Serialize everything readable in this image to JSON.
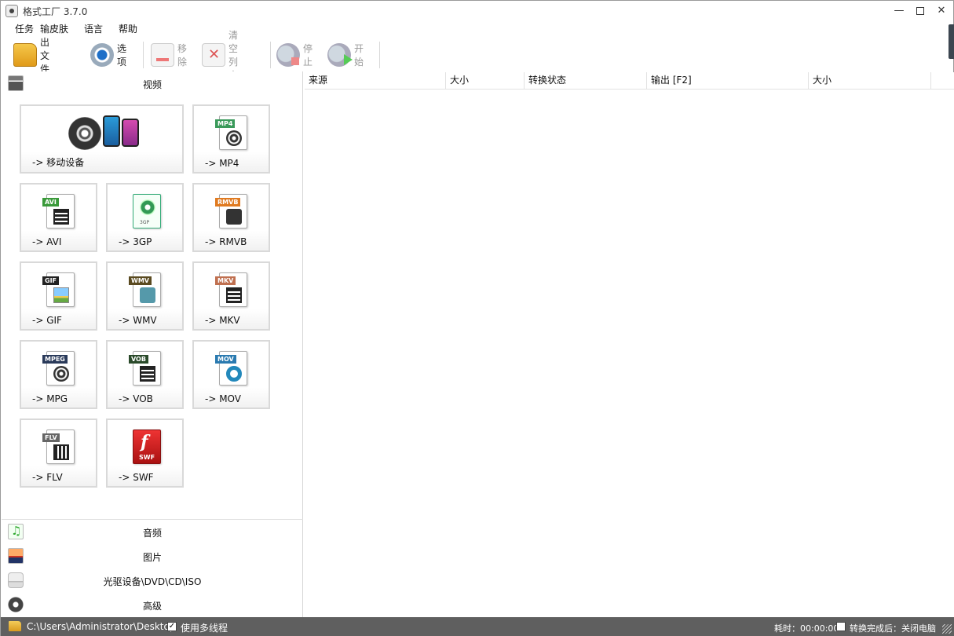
{
  "window": {
    "title": "格式工厂 3.7.0",
    "min": "—",
    "close": "✕"
  },
  "menu": [
    "任务",
    "皮肤",
    "语言",
    "帮助"
  ],
  "toolbar": {
    "output_folder": "输出文件夹",
    "options": "选项",
    "remove": "移除",
    "clear_list": "清空列表",
    "stop": "停止",
    "start": "开始"
  },
  "sections": {
    "video": "视频",
    "audio": "音频",
    "picture": "图片",
    "disc": "光驱设备\\DVD\\CD\\ISO",
    "advanced": "高级"
  },
  "video_tiles": [
    {
      "label": "-> 移动设备"
    },
    {
      "label": "-> MP4",
      "badge": "MP4",
      "color": "#3a9a5a"
    },
    {
      "label": "-> AVI",
      "badge": "AVI",
      "color": "#3a9a3a"
    },
    {
      "label": "-> 3GP"
    },
    {
      "label": "-> RMVB",
      "badge": "RMVB",
      "color": "#e07a20"
    },
    {
      "label": "-> GIF",
      "badge": "GIF",
      "color": "#222222"
    },
    {
      "label": "-> WMV",
      "badge": "WMV",
      "color": "#5a4a20"
    },
    {
      "label": "-> MKV",
      "badge": "MKV",
      "color": "#c07050"
    },
    {
      "label": "-> MPG",
      "badge": "MPEG",
      "color": "#2a3a5a"
    },
    {
      "label": "-> VOB",
      "badge": "VOB",
      "color": "#2a4a2a"
    },
    {
      "label": "-> MOV",
      "badge": "MOV",
      "color": "#2a7ab0"
    },
    {
      "label": "-> FLV",
      "badge": "FLV",
      "color": "#666666"
    },
    {
      "label": "-> SWF"
    }
  ],
  "tile_glyphs": {
    "threegp": "3GP",
    "swf_f": "f",
    "swf": "SWF"
  },
  "list_columns": [
    "来源",
    "大小",
    "转换状态",
    "输出 [F2]",
    "大小"
  ],
  "status": {
    "path": "C:\\Users\\Administrator\\Desktop",
    "multithread_label": "使用多线程",
    "multithread_checked": "✓",
    "elapsed": "耗时：00:00:00",
    "after_convert": "转换完成后：关闭电脑"
  }
}
